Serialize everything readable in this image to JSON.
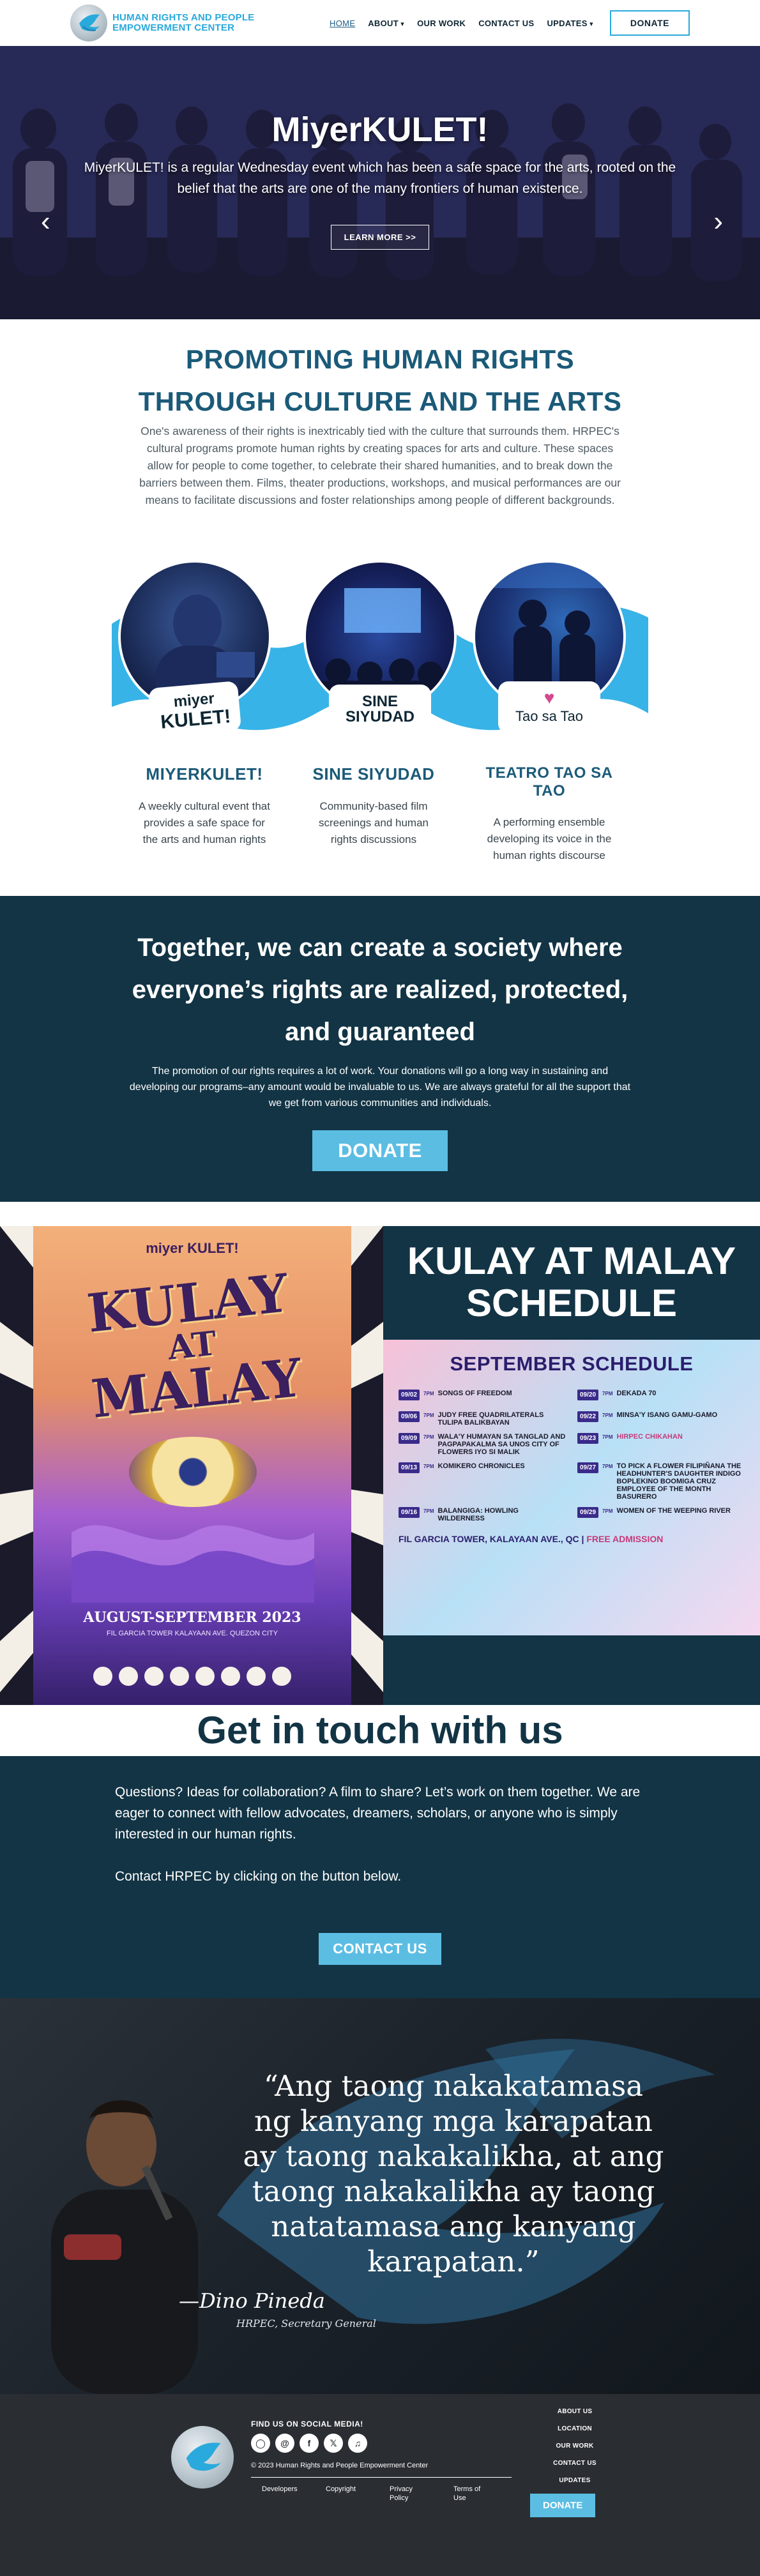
{
  "header": {
    "logo_line1": "HUMAN RIGHTS AND PEOPLE",
    "logo_line2": "EMPOWERMENT CENTER",
    "nav": [
      {
        "label": "HOME"
      },
      {
        "label": "ABOUT"
      },
      {
        "label": "OUR WORK"
      },
      {
        "label": "CONTACT US"
      },
      {
        "label": "UPDATES"
      }
    ],
    "donate_label": "DONATE"
  },
  "hero": {
    "title": "MiyerKULET!",
    "text": "MiyerKULET! is a regular Wednesday event which has been a safe space for the arts, rooted on the belief that the arts are one of the many frontiers of human existence.",
    "button_label": "LEARN MORE >>"
  },
  "programs": {
    "heading_line1": "PROMOTING HUMAN RIGHTS",
    "heading_line2": "THROUGH CULTURE AND THE ARTS",
    "intro": "One's awareness of their rights is inextricably tied with the culture that surrounds them. HRPEC's cultural programs promote human rights by creating spaces for arts and culture. These spaces allow for people to come together, to celebrate their shared humanities, and to break down the barriers between them. Films, theater productions, workshops, and musical performances are our means to facilitate discussions and foster relationships among people of different backgrounds.",
    "badges": {
      "miyer_top": "miyer",
      "miyer_bottom": "KULET!",
      "sine_top": "SINE",
      "sine_bottom": "SIYUDAD",
      "tao": "Tao sa Tao"
    },
    "items": [
      {
        "title": "MIYERKULET!",
        "desc": "A weekly cultural event that provides a safe space for the arts and human rights"
      },
      {
        "title": "SINE SIYUDAD",
        "desc": "Community-based film screenings and human rights discussions"
      },
      {
        "title": "TEATRO TAO SA TAO",
        "desc": "A performing ensemble developing its voice in the human rights discourse"
      }
    ]
  },
  "together": {
    "heading": "Together, we can create a society where everyone’s rights are realized, protected, and guaranteed",
    "text": "The promotion of our rights requires a lot of work. Your donations will go a long way in sustaining and developing our programs–any amount would be invaluable to us. We are always grateful for all the support that we get from various communities and individuals.",
    "donate_label": "DONATE"
  },
  "kulay": {
    "heading_line1": "KULAY AT MALAY",
    "heading_line2": "SCHEDULE",
    "poster": {
      "top": "miyer KULET!",
      "title_line1": "KULAY",
      "title_line2": "AT",
      "title_line3": "MALAY",
      "date": "AUGUST-SEPTEMBER 2023",
      "venue": "FIL GARCIA TOWER KALAYAAN AVE. QUEZON CITY"
    },
    "schedule_title": "SEPTEMBER SCHEDULE",
    "schedule_left": [
      {
        "date": "09/02",
        "time": "7PM",
        "title": "SONGS OF FREEDOM",
        "pink": false
      },
      {
        "date": "09/06",
        "time": "7PM",
        "title": "JUDY FREE QUADRILATERALS TULIPA BALIKBAYAN",
        "pink": false
      },
      {
        "date": "09/09",
        "time": "7PM",
        "title": "WALA'Y HUMAYAN SA TANGLAD AND PAGPAPAKALMA SA UNOS CITY OF FLOWERS IYO SI MALIK",
        "pink": false
      },
      {
        "date": "09/13",
        "time": "7PM",
        "title": "KOMIKERO CHRONICLES",
        "pink": false
      },
      {
        "date": "09/16",
        "time": "7PM",
        "title": "BALANGIGA: HOWLING WILDERNESS",
        "pink": false
      }
    ],
    "schedule_right": [
      {
        "date": "09/20",
        "time": "7PM",
        "title": "DEKADA 70",
        "pink": false
      },
      {
        "date": "09/22",
        "time": "7PM",
        "title": "MINSA'Y ISANG GAMU-GAMO",
        "pink": false
      },
      {
        "date": "09/23",
        "time": "7PM",
        "title": "HIRPEC CHIKAHAN",
        "pink": true
      },
      {
        "date": "09/27",
        "time": "7PM",
        "title": "TO PICK A FLOWER FILIPIÑANA THE HEADHUNTER'S DAUGHTER INDIGO BOPLEKINO BOOMIGA CRUZ EMPLOYEE OF THE MONTH BASURERO",
        "pink": false
      },
      {
        "date": "09/29",
        "time": "7PM",
        "title": "WOMEN OF THE WEEPING RIVER",
        "pink": false
      }
    ],
    "schedule_footer": "FIL GARCIA TOWER, KALAYAAN AVE., QC |",
    "schedule_free": "FREE ADMISSION"
  },
  "contact": {
    "heading": "Get in touch with us",
    "text1": "Questions? Ideas for collaboration? A film to share? Let’s work on them together. We are eager to connect with fellow advocates, dreamers, scholars, or anyone who is simply interested in our human rights.",
    "text2": "Contact HRPEC by clicking on the button below.",
    "button_label": "CONTACT US"
  },
  "quote": {
    "text": "“Ang taong nakakatamasa ng kanyang mga karapatan ay taong nakakalikha, at ang taong nakakalikha ay taong natatamasa ang kanyang karapatan.”",
    "author": "—Dino Pineda",
    "role": "HRPEC, Secretary General"
  },
  "footer": {
    "social_title": "FIND US ON SOCIAL MEDIA!",
    "copyright": "© 2023 Human Rights and People Empowerment Center",
    "links": [
      "Developers",
      "Copyright",
      "Privacy Policy",
      "Terms of Use"
    ],
    "menu": [
      "ABOUT US",
      "LOCATION",
      "OUR WORK",
      "CONTACT US",
      "UPDATES"
    ],
    "donate_label": "DONATE",
    "social_icons": [
      "instagram-icon",
      "threads-icon",
      "facebook-icon",
      "x-icon",
      "tiktok-icon"
    ]
  },
  "colors": {
    "brand_blue": "#2aa9dc",
    "navy": "#123445",
    "heading_teal": "#1b5a78",
    "button_blue": "#5cbde3",
    "footer_bg": "#2a2e33"
  }
}
